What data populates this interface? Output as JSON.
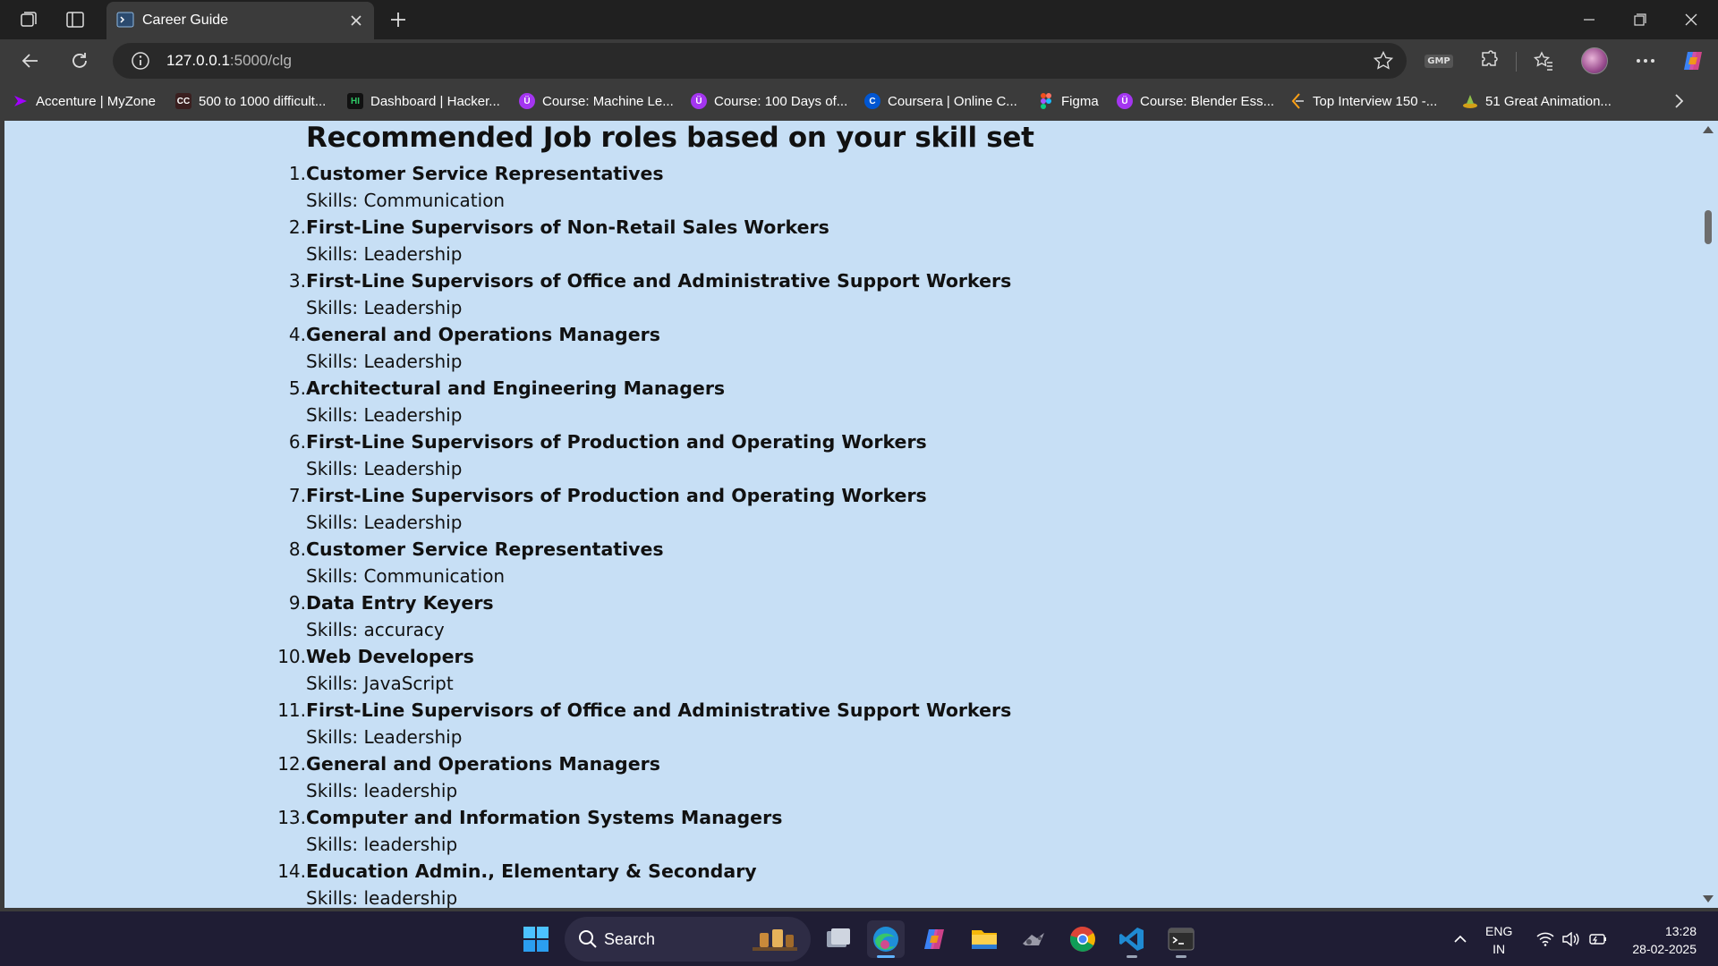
{
  "browser": {
    "tab_title": "Career Guide",
    "url_host": "127.0.0.1",
    "url_path": ":5000/clg"
  },
  "bookmarks": [
    {
      "label": "Accenture | MyZone",
      "icon": "accenture-icon",
      "color": "#a100ff"
    },
    {
      "label": "500 to 1000 difficult...",
      "icon": "cc-icon",
      "color": "#3a1f1f"
    },
    {
      "label": "Dashboard | Hacker...",
      "icon": "hackerrank-icon",
      "color": "#111111"
    },
    {
      "label": "Course: Machine Le...",
      "icon": "udemy-icon",
      "color": "#a435f0"
    },
    {
      "label": "Course: 100 Days of...",
      "icon": "udemy-icon",
      "color": "#a435f0"
    },
    {
      "label": "Coursera | Online C...",
      "icon": "coursera-icon",
      "color": "#0056d2"
    },
    {
      "label": "Figma",
      "icon": "figma-icon",
      "color": "#f24e1e"
    },
    {
      "label": "Course: Blender Ess...",
      "icon": "udemy-icon",
      "color": "#a435f0"
    },
    {
      "label": "Top Interview 150 -...",
      "icon": "leetcode-icon",
      "color": "#ffa116"
    },
    {
      "label": "51 Great Animation...",
      "icon": "animation-icon",
      "color": "#d4a017"
    }
  ],
  "page": {
    "heading": "Recommended Job roles based on your skill set",
    "jobs": [
      {
        "num": "1.",
        "title": "Customer Service Representatives",
        "skills": "Skills: Communication"
      },
      {
        "num": "2.",
        "title": "First-Line Supervisors of Non-Retail Sales Workers",
        "skills": "Skills: Leadership"
      },
      {
        "num": "3.",
        "title": "First-Line Supervisors of Office and Administrative Support Workers",
        "skills": "Skills: Leadership"
      },
      {
        "num": "4.",
        "title": "General and Operations Managers",
        "skills": "Skills: Leadership"
      },
      {
        "num": "5.",
        "title": "Architectural and Engineering Managers",
        "skills": "Skills: Leadership"
      },
      {
        "num": "6.",
        "title": "First-Line Supervisors of Production and Operating Workers",
        "skills": "Skills: Leadership"
      },
      {
        "num": "7.",
        "title": "First-Line Supervisors of Production and Operating Workers",
        "skills": "Skills: Leadership"
      },
      {
        "num": "8.",
        "title": "Customer Service Representatives",
        "skills": "Skills: Communication"
      },
      {
        "num": "9.",
        "title": "Data Entry Keyers",
        "skills": "Skills: accuracy"
      },
      {
        "num": "10.",
        "title": "Web Developers",
        "skills": "Skills: JavaScript"
      },
      {
        "num": "11.",
        "title": "First-Line Supervisors of Office and Administrative Support Workers",
        "skills": "Skills: Leadership"
      },
      {
        "num": "12.",
        "title": "General and Operations Managers",
        "skills": "Skills: leadership"
      },
      {
        "num": "13.",
        "title": "Computer and Information Systems Managers",
        "skills": "Skills: leadership"
      },
      {
        "num": "14.",
        "title": "Education Admin., Elementary & Secondary",
        "skills": "Skills: leadership"
      }
    ]
  },
  "taskbar": {
    "search_label": "Search",
    "lang_line1": "ENG",
    "lang_line2": "IN",
    "time": "13:28",
    "date": "28-02-2025"
  },
  "extensions": {
    "gmp_label": "GMP"
  }
}
